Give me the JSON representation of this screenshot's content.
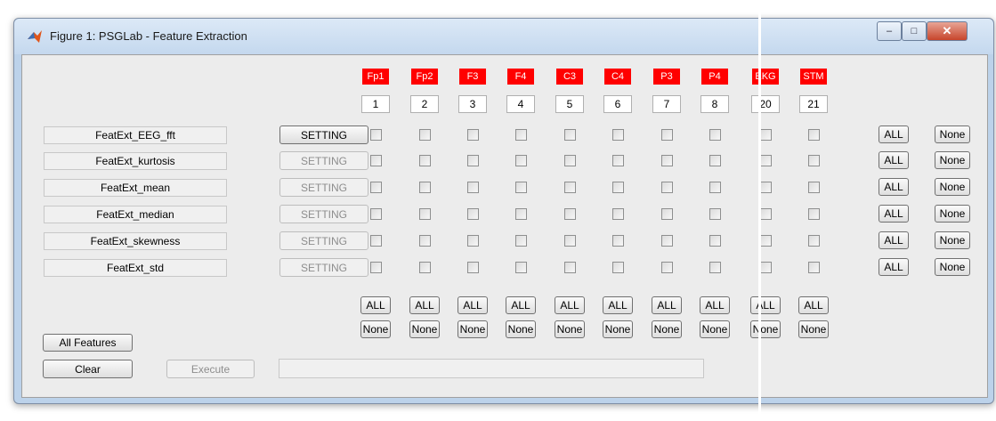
{
  "window": {
    "title": "Figure 1: PSGLab - Feature Extraction"
  },
  "titlebar_buttons": {
    "minimize": "–",
    "maximize": "□",
    "close": "✕"
  },
  "channels": [
    {
      "name": "Fp1",
      "number": "1"
    },
    {
      "name": "Fp2",
      "number": "2"
    },
    {
      "name": "F3",
      "number": "3"
    },
    {
      "name": "F4",
      "number": "4"
    },
    {
      "name": "C3",
      "number": "5"
    },
    {
      "name": "C4",
      "number": "6"
    },
    {
      "name": "P3",
      "number": "7"
    },
    {
      "name": "P4",
      "number": "8"
    },
    {
      "name": "EKG",
      "number": "20"
    },
    {
      "name": "STM",
      "number": "21"
    }
  ],
  "features": [
    {
      "name": "FeatExt_EEG_fft",
      "setting_label": "SETTING",
      "setting_enabled": true
    },
    {
      "name": "FeatExt_kurtosis",
      "setting_label": "SETTING",
      "setting_enabled": false
    },
    {
      "name": "FeatExt_mean",
      "setting_label": "SETTING",
      "setting_enabled": false
    },
    {
      "name": "FeatExt_median",
      "setting_label": "SETTING",
      "setting_enabled": false
    },
    {
      "name": "FeatExt_skewness",
      "setting_label": "SETTING",
      "setting_enabled": false
    },
    {
      "name": "FeatExt_std",
      "setting_label": "SETTING",
      "setting_enabled": false
    }
  ],
  "labels": {
    "all": "ALL",
    "none": "None",
    "all_features": "All Features",
    "clear": "Clear",
    "execute": "Execute"
  },
  "status_text": "",
  "colors": {
    "channel_header": "#ff0000",
    "panel_bg": "#ececec",
    "window_frame": "#bcd2ea"
  }
}
